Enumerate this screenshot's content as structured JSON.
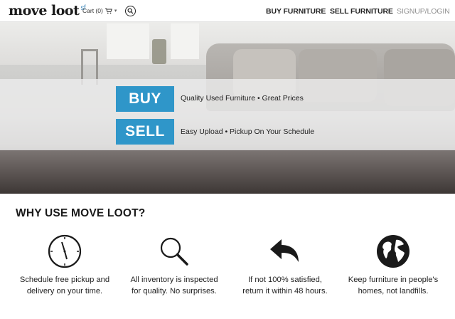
{
  "header": {
    "logo": "move loot",
    "logo_suffix": "sf",
    "cart_label": "Cart (0)",
    "cart_icon": "cart-icon",
    "search_icon": "search-icon",
    "nav": {
      "buy": "BUY FURNITURE",
      "sell": "SELL FURNITURE",
      "signup": "SIGNUP/LOGIN"
    }
  },
  "hero": {
    "buy_button": "BUY",
    "buy_tagline": "Quality Used Furniture • Great Prices",
    "sell_button": "SELL",
    "sell_tagline": "Easy Upload • Pickup On Your Schedule",
    "button_color": "#2f96c9"
  },
  "why": {
    "title": "WHY USE MOVE LOOT?",
    "features": [
      {
        "icon": "clock-icon",
        "line1": "Schedule free pickup and",
        "line2": "delivery on your time."
      },
      {
        "icon": "magnifier-icon",
        "line1": "All inventory is inspected",
        "line2": "for quality. No surprises."
      },
      {
        "icon": "return-arrow-icon",
        "line1": "If not 100% satisfied,",
        "line2": "return it within 48 hours."
      },
      {
        "icon": "globe-icon",
        "line1": "Keep furniture in people's",
        "line2": "homes, not landfills."
      }
    ]
  }
}
